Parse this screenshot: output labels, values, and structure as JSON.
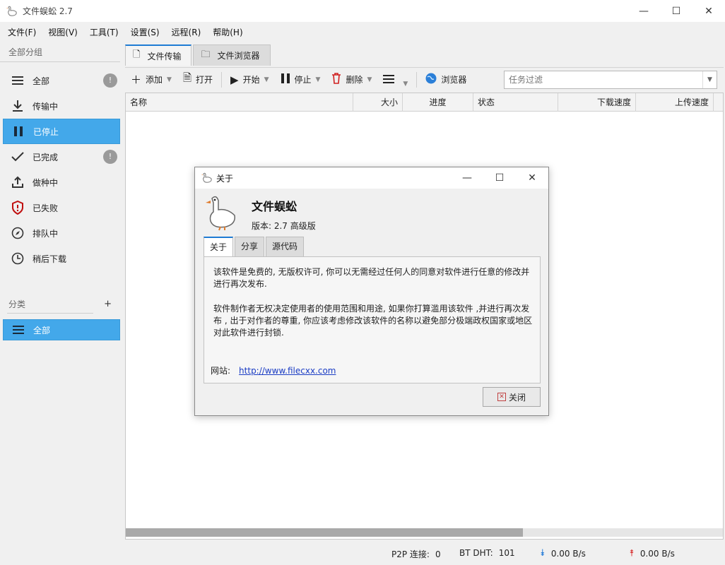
{
  "window": {
    "title": "文件蜈蚣 2.7"
  },
  "menu": [
    "文件(F)",
    "视图(V)",
    "工具(T)",
    "设置(S)",
    "远程(R)",
    "帮助(H)"
  ],
  "sidebar": {
    "group_header": "全部分组",
    "items": [
      {
        "label": "全部",
        "icon": "list-icon",
        "badge": "!"
      },
      {
        "label": "传输中",
        "icon": "download-icon",
        "badge": ""
      },
      {
        "label": "已停止",
        "icon": "pause-icon",
        "badge": "",
        "selected": true
      },
      {
        "label": "已完成",
        "icon": "check-icon",
        "badge": "!"
      },
      {
        "label": "做种中",
        "icon": "upload-icon",
        "badge": ""
      },
      {
        "label": "已失败",
        "icon": "shield-alert-icon",
        "badge": ""
      },
      {
        "label": "排队中",
        "icon": "compass-icon",
        "badge": ""
      },
      {
        "label": "稍后下载",
        "icon": "clock-icon",
        "badge": ""
      }
    ],
    "category_header": "分类",
    "category_add": "+",
    "category_items": [
      {
        "label": "全部",
        "icon": "list-icon",
        "selected": true
      }
    ]
  },
  "tabs": [
    {
      "label": "文件传输",
      "icon": "file-icon",
      "active": true
    },
    {
      "label": "文件浏览器",
      "icon": "folder-icon",
      "active": false
    }
  ],
  "toolbar": {
    "add": "添加",
    "open": "打开",
    "start": "开始",
    "stop": "停止",
    "delete": "删除",
    "browser": "浏览器",
    "filter_placeholder": "任务过滤"
  },
  "table": {
    "columns": [
      "名称",
      "大小",
      "进度",
      "状态",
      "下载速度",
      "上传速度"
    ],
    "rows": []
  },
  "status": {
    "p2p_label": "P2P 连接:",
    "p2p_value": "0",
    "dht_label": "BT DHT:",
    "dht_value": "101",
    "down_speed": "0.00 B/s",
    "up_speed": "0.00 B/s"
  },
  "dialog": {
    "title": "关于",
    "app_name": "文件蜈蚣",
    "version": "版本: 2.7 高级版",
    "tabs": [
      "关于",
      "分享",
      "源代码"
    ],
    "para1": "该软件是免费的, 无版权许可, 你可以无需经过任何人的同意对软件进行任意的修改并进行再次发布.",
    "para2": "软件制作者无权决定使用者的使用范围和用途, 如果你打算滥用该软件 ,并进行再次发布 , 出于对作者的尊重, 你应该考虑修改该软件的名称以避免部分极端政权国家或地区对此软件进行封锁.",
    "site_label": "网站:",
    "site_url": "http://www.filecxx.com",
    "close": "关闭"
  },
  "colors": {
    "accent": "#43a8ea",
    "tab_accent": "#1e7bd4",
    "link": "#1a3cc4"
  }
}
